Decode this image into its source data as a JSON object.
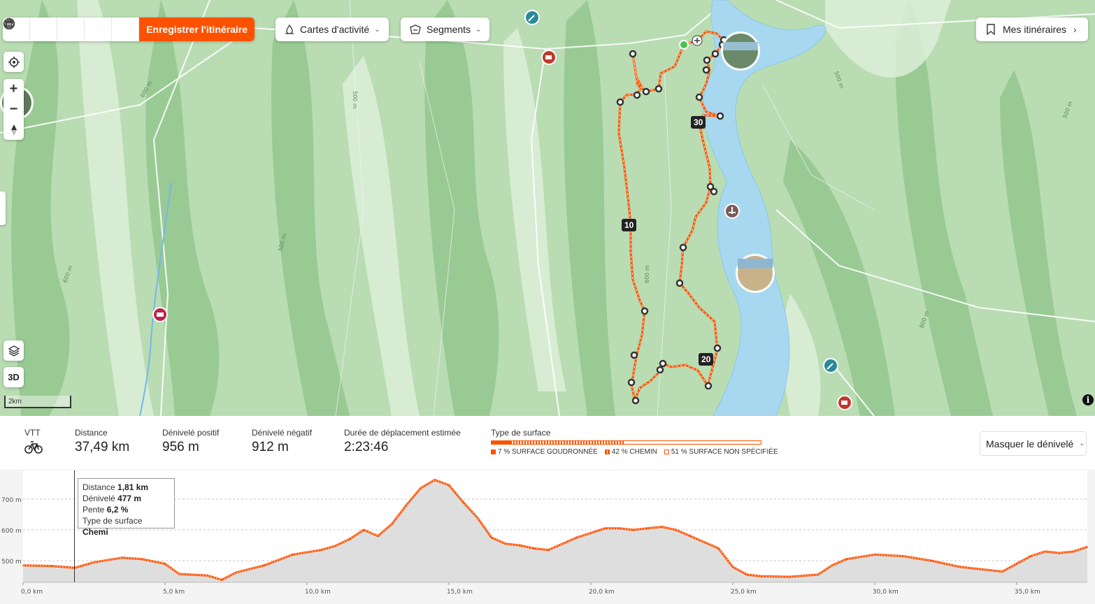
{
  "toolbar": {
    "save_label": "Enregistrer l'itinéraire",
    "heatmap_label": "Cartes d'activité",
    "segments_label": "Segments",
    "my_routes_label": "Mes itinéraires"
  },
  "map": {
    "scale_label": "2km",
    "btn3d_label": "3D",
    "km_markers": [
      "10",
      "20",
      "30"
    ],
    "contour_labels": [
      "600 m",
      "600 m",
      "500 m",
      "500 m",
      "600 m",
      "500 m",
      "500 m",
      "800 m"
    ],
    "colors": {
      "route": "#fc5200",
      "water": "#a7d8f0",
      "land": "#b9dcb3"
    }
  },
  "stats": {
    "activity": {
      "label": "VTT",
      "icon": "mtb-bike-icon"
    },
    "distance": {
      "label": "Distance",
      "value": "37,49 km"
    },
    "gain": {
      "label": "Dénivelé positif",
      "value": "956 m"
    },
    "loss": {
      "label": "Dénivelé négatif",
      "value": "912 m"
    },
    "duration": {
      "label": "Durée de déplacement estimée",
      "value": "2:23:46"
    },
    "surface": {
      "label": "Type de surface",
      "items": [
        {
          "text": "7 % SURFACE GOUDRONNÉE",
          "pct": 7
        },
        {
          "text": "42 % CHEMIN",
          "pct": 42
        },
        {
          "text": "51 % SURFACE NON SPÉCIFIÉE",
          "pct": 51
        }
      ]
    },
    "elevation_toggle_label": "Masquer le dénivelé"
  },
  "profile": {
    "tooltip": {
      "distance_label": "Distance",
      "distance_value": "1,81 km",
      "elev_label": "Dénivelé",
      "elev_value": "477 m",
      "grade_label": "Pente",
      "grade_value": "6,2 %",
      "surface_label": "Type de surface",
      "surface_value": "Chemi"
    }
  },
  "chart_data": {
    "type": "area",
    "title": "",
    "xlabel": "",
    "ylabel": "",
    "x_unit": "km",
    "y_unit": "m",
    "xlim": [
      0,
      37.49
    ],
    "ylim": [
      430,
      770
    ],
    "x_ticks": [
      "0,0 km",
      "5,0 km",
      "10,0 km",
      "15,0 km",
      "20,0 km",
      "25,0 km",
      "30,0 km",
      "35,0 km"
    ],
    "y_ticks": [
      "500 m",
      "600 m",
      "700 m"
    ],
    "grid": true,
    "cursor_x": 1.81,
    "x": [
      0,
      1,
      1.81,
      2.5,
      3.5,
      4.2,
      5,
      5.5,
      6.5,
      7,
      7.5,
      8.5,
      9.5,
      10.5,
      11,
      11.5,
      12,
      12.5,
      13,
      13.5,
      14,
      14.5,
      15,
      15.5,
      16,
      16.5,
      17,
      17.5,
      18,
      18.5,
      19,
      19.5,
      20,
      20.5,
      21,
      21.5,
      22,
      22.5,
      23,
      23.5,
      24,
      24.5,
      25,
      25.5,
      26,
      27,
      28,
      28.5,
      29,
      30,
      31,
      32,
      33,
      34,
      34.5,
      35,
      35.5,
      36,
      36.5,
      37,
      37.49
    ],
    "values": [
      485,
      483,
      477,
      495,
      510,
      505,
      490,
      457,
      452,
      438,
      462,
      485,
      520,
      535,
      548,
      570,
      600,
      580,
      620,
      680,
      735,
      762,
      745,
      690,
      640,
      575,
      555,
      550,
      540,
      535,
      555,
      575,
      590,
      605,
      605,
      600,
      605,
      610,
      600,
      580,
      560,
      540,
      480,
      455,
      450,
      448,
      455,
      485,
      505,
      520,
      515,
      500,
      480,
      470,
      465,
      490,
      515,
      530,
      525,
      530,
      545
    ]
  }
}
